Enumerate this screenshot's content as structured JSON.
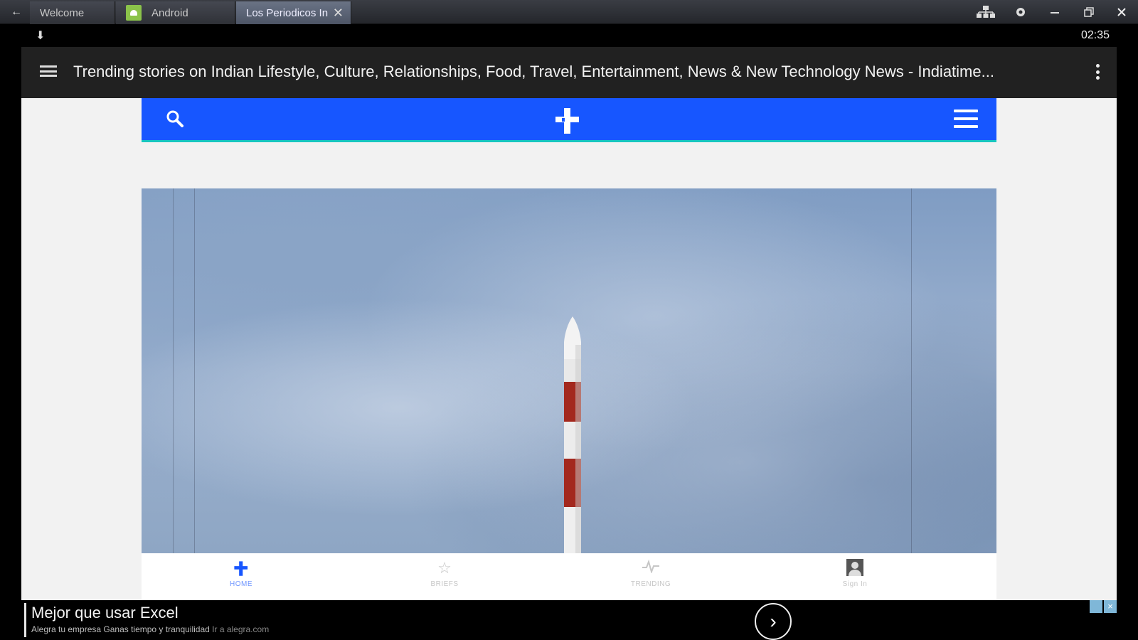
{
  "emulator": {
    "tabs": [
      {
        "label": "Welcome"
      },
      {
        "label": "Android"
      },
      {
        "label": "Los Periodicos In",
        "active": true
      }
    ],
    "close_tab_glyph": "✕"
  },
  "status_bar": {
    "time": "02:35"
  },
  "app_bar": {
    "title": "Trending stories on Indian Lifestyle, Culture, Relationships, Food, Travel, Entertainment, News & New Technology News - Indiatime..."
  },
  "site": {
    "header_color": "#1756ff",
    "accent_color": "#17c6c0",
    "hero_image": "rocket on launch pad against cloudy sky",
    "bottom_nav": [
      {
        "label": "HOME",
        "icon": "indiatimes-logo-icon",
        "active": true
      },
      {
        "label": "BRIEFS",
        "icon": "star-icon"
      },
      {
        "label": "TRENDING",
        "icon": "pulse-icon"
      },
      {
        "label": "Sign In",
        "icon": "user-icon"
      }
    ]
  },
  "ad": {
    "headline": "Mejor que usar Excel",
    "subtext": "Alegra tu empresa Ganas tiempo y tranquilidad",
    "link_text": "Ir a alegra.com"
  }
}
